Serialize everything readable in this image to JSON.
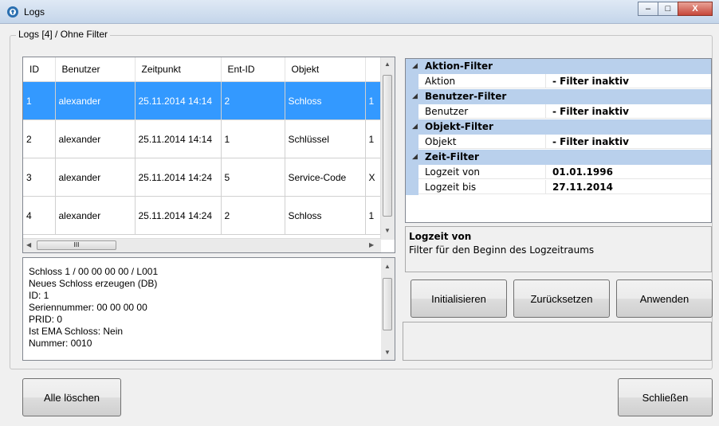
{
  "window": {
    "title": "Logs",
    "minimize": "–",
    "maximize": "□",
    "close": "X"
  },
  "group_label": "Logs [4] / Ohne Filter",
  "grid": {
    "columns": [
      "ID",
      "Benutzer",
      "Zeitpunkt",
      "Ent-ID",
      "Objekt"
    ],
    "rows": [
      [
        "1",
        "alexander",
        "25.11.2014 14:14",
        "2",
        "Schloss",
        "1"
      ],
      [
        "2",
        "alexander",
        "25.11.2014 14:14",
        "1",
        "Schlüssel",
        "1"
      ],
      [
        "3",
        "alexander",
        "25.11.2014 14:24",
        "5",
        "Service-Code",
        "X"
      ],
      [
        "4",
        "alexander",
        "25.11.2014 14:24",
        "2",
        "Schloss",
        "1"
      ]
    ],
    "hscroll_grip": "III"
  },
  "detail": [
    "Schloss    1 / 00 00 00 00 / L001",
    "Neues Schloss erzeugen (DB)",
    "ID: 1",
    "Seriennummer: 00 00 00 00",
    "PRID: 0",
    "Ist EMA Schloss: Nein",
    "Nummer: 0010"
  ],
  "filters": {
    "aktion": {
      "category": "Aktion-Filter",
      "label": "Aktion",
      "value": "- Filter inaktiv"
    },
    "benutzer": {
      "category": "Benutzer-Filter",
      "label": "Benutzer",
      "value": "- Filter inaktiv"
    },
    "objekt": {
      "category": "Objekt-Filter",
      "label": "Objekt",
      "value": "- Filter inaktiv"
    },
    "zeit": {
      "category": "Zeit-Filter",
      "von_label": "Logzeit von",
      "von_value": "01.01.1996",
      "bis_label": "Logzeit bis",
      "bis_value": "27.11.2014"
    }
  },
  "help": {
    "title": "Logzeit von",
    "description": "Filter für den Beginn des Logzeitraums"
  },
  "buttons": {
    "initialisieren": "Initialisieren",
    "zuruecksetzen": "Zurücksetzen",
    "anwenden": "Anwenden",
    "alle_loeschen": "Alle löschen",
    "schliessen": "Schließen"
  },
  "colors": {
    "selection": "#3399ff",
    "category_bg": "#b9d0ec"
  }
}
